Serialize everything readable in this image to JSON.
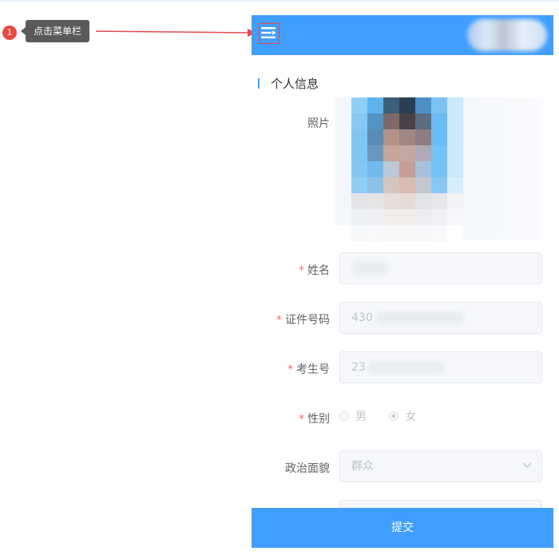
{
  "annotation": {
    "step": "1",
    "tip": "点击菜单栏"
  },
  "section_title": "个人信息",
  "form": {
    "photo_label": "照片",
    "name_label": "姓名",
    "id_label": "证件号码",
    "id_value": "430",
    "exam_label": "考生号",
    "exam_value": "23",
    "gender_label": "性别",
    "gender_options": [
      "男",
      "女"
    ],
    "gender_selected": "女",
    "politics_label": "政治面貌",
    "politics_value": "群众"
  },
  "submit_label": "提交",
  "colors": {
    "primary": "#409eff",
    "required": "#f56c6c",
    "annotation_red": "#e9473f"
  },
  "icons": [
    "menu-icon",
    "chevron-down-icon"
  ]
}
